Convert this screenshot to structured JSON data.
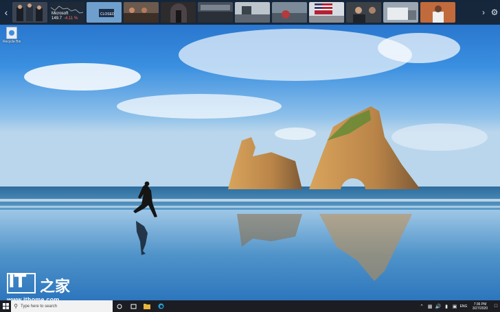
{
  "newsbar": {
    "prev_icon": "chevron-left-icon",
    "next_icon": "chevron-right-icon",
    "settings_icon": "gear-icon",
    "stock_card": {
      "name": "Microsoft",
      "value": "149.7",
      "change": "-4.11 %"
    },
    "news_card_caption": "CLOSED"
  },
  "desktop": {
    "icon_label": "Recycle Bin"
  },
  "logo": {
    "it": "IT",
    "cn": "之家",
    "url": "www.ithome.com"
  },
  "taskbar": {
    "search_placeholder": "Type here to search",
    "language": "ENG",
    "time": "7:36 PM",
    "date": "3/27/2020"
  },
  "colors": {
    "taskbar": "#1c1d22",
    "sky": "#2c7bd0",
    "accent": "#0078d7"
  }
}
